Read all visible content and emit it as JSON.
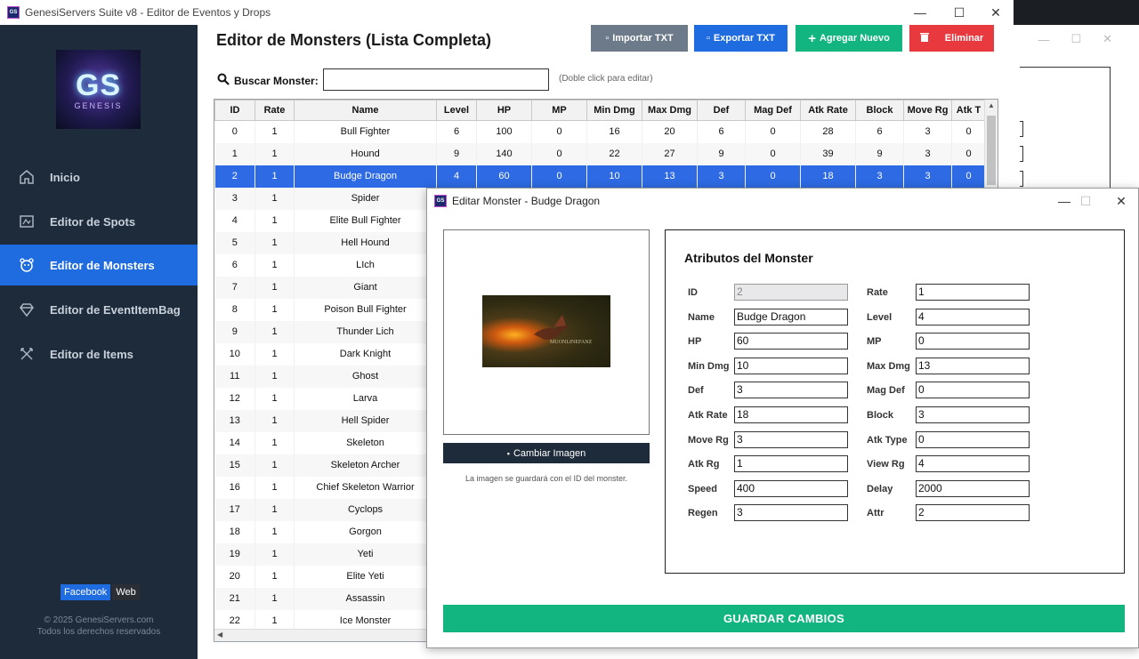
{
  "window": {
    "title": "GenesiServers Suite v8 - Editor de Eventos y Drops",
    "app_icon": "GS"
  },
  "sidebar": {
    "logo": {
      "main": "GS",
      "sub": "GENESIS"
    },
    "items": [
      {
        "label": "Inicio",
        "icon": "home-icon"
      },
      {
        "label": "Editor de Spots",
        "icon": "map-icon"
      },
      {
        "label": "Editor de Monsters",
        "icon": "monster-icon",
        "active": true
      },
      {
        "label": "Editor de EventItemBag",
        "icon": "diamond-icon"
      },
      {
        "label": "Editor de Items",
        "icon": "swords-icon"
      }
    ],
    "social": {
      "facebook": "Facebook",
      "web": "Web"
    },
    "copyright": "© 2025 GenesiServers.com",
    "rights": "Todos los derechos reservados"
  },
  "main": {
    "title": "Editor de Monsters (Lista Completa)",
    "buttons": {
      "import": "Importar TXT",
      "export": "Exportar TXT",
      "add": "Agregar Nuevo",
      "delete": "Eliminar"
    },
    "search": {
      "label": "Buscar Monster:",
      "value": "",
      "hint": "(Doble click para editar)"
    }
  },
  "table": {
    "columns": [
      "ID",
      "Rate",
      "Name",
      "Level",
      "HP",
      "MP",
      "Min Dmg",
      "Max Dmg",
      "Def",
      "Mag Def",
      "Atk Rate",
      "Block",
      "Move Rg",
      "Atk T"
    ],
    "rows": [
      [
        "0",
        "1",
        "Bull Fighter",
        "6",
        "100",
        "0",
        "16",
        "20",
        "6",
        "0",
        "28",
        "6",
        "3",
        "0"
      ],
      [
        "1",
        "1",
        "Hound",
        "9",
        "140",
        "0",
        "22",
        "27",
        "9",
        "0",
        "39",
        "9",
        "3",
        "0"
      ],
      [
        "2",
        "1",
        "Budge Dragon",
        "4",
        "60",
        "0",
        "10",
        "13",
        "3",
        "0",
        "18",
        "3",
        "3",
        "0"
      ],
      [
        "3",
        "1",
        "Spider",
        "",
        "",
        "",
        "",
        "",
        "",
        "",
        "",
        "",
        "",
        ""
      ],
      [
        "4",
        "1",
        "Elite Bull Fighter",
        "",
        "",
        "",
        "",
        "",
        "",
        "",
        "",
        "",
        "",
        ""
      ],
      [
        "5",
        "1",
        "Hell Hound",
        "",
        "",
        "",
        "",
        "",
        "",
        "",
        "",
        "",
        "",
        ""
      ],
      [
        "6",
        "1",
        "LIch",
        "",
        "",
        "",
        "",
        "",
        "",
        "",
        "",
        "",
        "",
        ""
      ],
      [
        "7",
        "1",
        "Giant",
        "",
        "",
        "",
        "",
        "",
        "",
        "",
        "",
        "",
        "",
        ""
      ],
      [
        "8",
        "1",
        "Poison Bull Fighter",
        "",
        "",
        "",
        "",
        "",
        "",
        "",
        "",
        "",
        "",
        ""
      ],
      [
        "9",
        "1",
        "Thunder Lich",
        "",
        "",
        "",
        "",
        "",
        "",
        "",
        "",
        "",
        "",
        ""
      ],
      [
        "10",
        "1",
        "Dark Knight",
        "",
        "",
        "",
        "",
        "",
        "",
        "",
        "",
        "",
        "",
        ""
      ],
      [
        "11",
        "1",
        "Ghost",
        "",
        "",
        "",
        "",
        "",
        "",
        "",
        "",
        "",
        "",
        ""
      ],
      [
        "12",
        "1",
        "Larva",
        "",
        "",
        "",
        "",
        "",
        "",
        "",
        "",
        "",
        "",
        ""
      ],
      [
        "13",
        "1",
        "Hell Spider",
        "",
        "",
        "",
        "",
        "",
        "",
        "",
        "",
        "",
        "",
        ""
      ],
      [
        "14",
        "1",
        "Skeleton",
        "",
        "",
        "",
        "",
        "",
        "",
        "",
        "",
        "",
        "",
        ""
      ],
      [
        "15",
        "1",
        "Skeleton Archer",
        "",
        "",
        "",
        "",
        "",
        "",
        "",
        "",
        "",
        "",
        ""
      ],
      [
        "16",
        "1",
        "Chief Skeleton Warrior",
        "",
        "",
        "",
        "",
        "",
        "",
        "",
        "",
        "",
        "",
        ""
      ],
      [
        "17",
        "1",
        "Cyclops",
        "",
        "",
        "",
        "",
        "",
        "",
        "",
        "",
        "",
        "",
        ""
      ],
      [
        "18",
        "1",
        "Gorgon",
        "",
        "",
        "",
        "",
        "",
        "",
        "",
        "",
        "",
        "",
        ""
      ],
      [
        "19",
        "1",
        "Yeti",
        "",
        "",
        "",
        "",
        "",
        "",
        "",
        "",
        "",
        "",
        ""
      ],
      [
        "20",
        "1",
        "Elite Yeti",
        "",
        "",
        "",
        "",
        "",
        "",
        "",
        "",
        "",
        "",
        ""
      ],
      [
        "21",
        "1",
        "Assassin",
        "",
        "",
        "",
        "",
        "",
        "",
        "",
        "",
        "",
        "",
        ""
      ],
      [
        "22",
        "1",
        "Ice Monster",
        "",
        "",
        "",
        "",
        "",
        "",
        "",
        "",
        "",
        "",
        ""
      ]
    ],
    "selected_index": 2
  },
  "dialog": {
    "title": "Editar Monster - Budge Dragon",
    "image_watermark": "MUONLINEFANZ",
    "change_image": "Cambiar Imagen",
    "image_note": "La imagen se guardará con el ID del monster.",
    "attr_title": "Atributos del Monster",
    "fields": [
      {
        "label": "ID",
        "value": "2",
        "readonly": true
      },
      {
        "label": "Rate",
        "value": "1"
      },
      {
        "label": "Name",
        "value": "Budge Dragon"
      },
      {
        "label": "Level",
        "value": "4"
      },
      {
        "label": "HP",
        "value": "60"
      },
      {
        "label": "MP",
        "value": "0"
      },
      {
        "label": "Min Dmg",
        "value": "10"
      },
      {
        "label": "Max Dmg",
        "value": "13"
      },
      {
        "label": "Def",
        "value": "3"
      },
      {
        "label": "Mag Def",
        "value": "0"
      },
      {
        "label": "Atk Rate",
        "value": "18"
      },
      {
        "label": "Block",
        "value": "3"
      },
      {
        "label": "Move Rg",
        "value": "3"
      },
      {
        "label": "Atk Type",
        "value": "0"
      },
      {
        "label": "Atk Rg",
        "value": "1"
      },
      {
        "label": "View Rg",
        "value": "4"
      },
      {
        "label": "Speed",
        "value": "400"
      },
      {
        "label": "Delay",
        "value": "2000"
      },
      {
        "label": "Regen",
        "value": "3"
      },
      {
        "label": "Attr",
        "value": "2"
      }
    ],
    "save": "GUARDAR CAMBIOS"
  },
  "colors": {
    "sidebar": "#1e2b3b",
    "active": "#1f6be0",
    "import": "#6c7a89",
    "export": "#1f6be0",
    "add": "#12b57f",
    "delete": "#e8393f",
    "save": "#12b57f"
  }
}
